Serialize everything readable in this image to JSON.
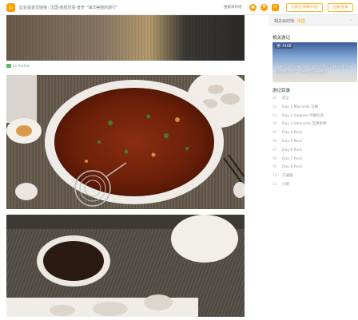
{
  "topbar": {
    "breadcrumb": [
      "此处是首页链接",
      "法国·南部风情·普罗 “海洋美丽的旅行”"
    ],
    "search_placeholder": "搜索目的地",
    "icons": [
      "home-icon",
      "bell-icon",
      "heart-icon",
      "message-icon"
    ],
    "btn_write": "写游记/攻略/问答",
    "btn_login": "注册/登录"
  },
  "photo_caption": "Le Parfait",
  "sidebar": {
    "destination_label": "相关目的地:",
    "destination_value": "法国",
    "related_title": "相关游记",
    "related_card": {
      "tag": "4168",
      "text": "跟着法国的印象，遇见最美的南法风情 之旅，体验浪漫的时光 分享南部风情之旅"
    },
    "toc_title": "游记目录",
    "toc": [
      {
        "num": "01",
        "label": "前言"
      },
      {
        "num": "02",
        "label": "Day 1 Marseille 马赛"
      },
      {
        "num": "03",
        "label": "Day 2 Avignon 阿维尼翁"
      },
      {
        "num": "04",
        "label": "Day 3 Valensole 瓦朗索勒"
      },
      {
        "num": "05",
        "label": "Day 4 Paris"
      },
      {
        "num": "06",
        "label": "Day 5 Paris"
      },
      {
        "num": "07",
        "label": "Day 6 Paris"
      },
      {
        "num": "08",
        "label": "Day 7 Paris"
      },
      {
        "num": "09",
        "label": "Day 8 Paris"
      },
      {
        "num": "10",
        "label": "交通篇"
      },
      {
        "num": "11",
        "label": "小结"
      }
    ]
  }
}
